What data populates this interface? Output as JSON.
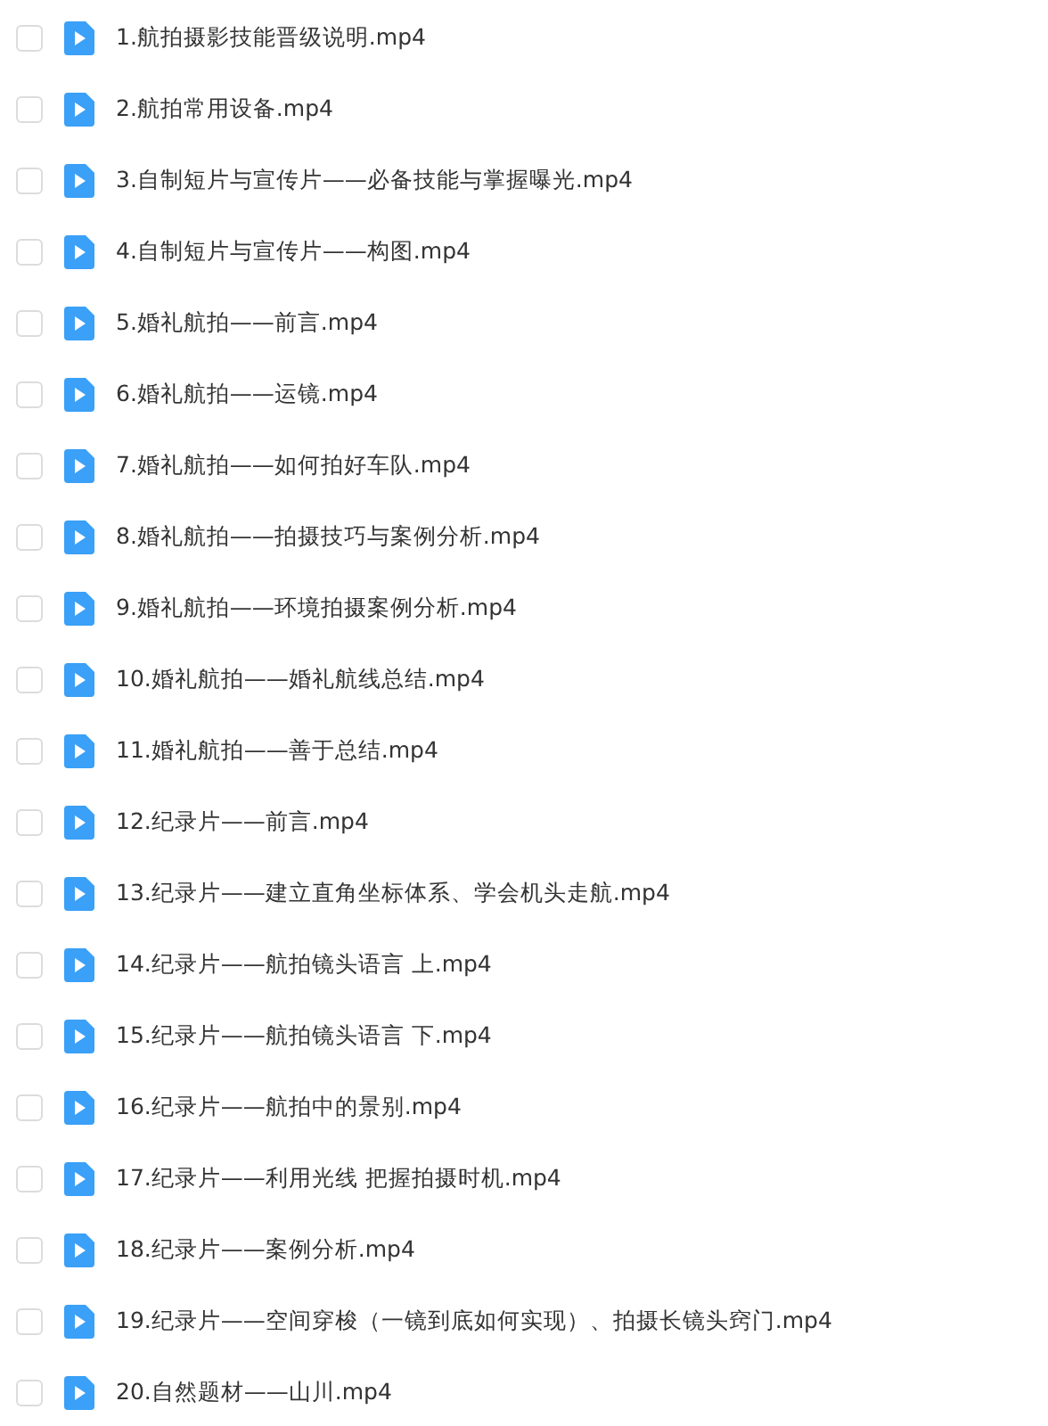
{
  "files": [
    {
      "name": "1.航拍摄影技能晋级说明.mp4",
      "checked": false
    },
    {
      "name": "2.航拍常用设备.mp4",
      "checked": false
    },
    {
      "name": "3.自制短片与宣传片——必备技能与掌握曝光.mp4",
      "checked": false
    },
    {
      "name": "4.自制短片与宣传片——构图.mp4",
      "checked": false
    },
    {
      "name": "5.婚礼航拍——前言.mp4",
      "checked": false
    },
    {
      "name": "6.婚礼航拍——运镜.mp4",
      "checked": false
    },
    {
      "name": "7.婚礼航拍——如何拍好车队.mp4",
      "checked": false
    },
    {
      "name": "8.婚礼航拍——拍摄技巧与案例分析.mp4",
      "checked": false
    },
    {
      "name": "9.婚礼航拍——环境拍摄案例分析.mp4",
      "checked": false
    },
    {
      "name": "10.婚礼航拍——婚礼航线总结.mp4",
      "checked": false
    },
    {
      "name": "11.婚礼航拍——善于总结.mp4",
      "checked": false
    },
    {
      "name": "12.纪录片——前言.mp4",
      "checked": false
    },
    {
      "name": "13.纪录片——建立直角坐标体系、学会机头走航.mp4",
      "checked": false
    },
    {
      "name": "14.纪录片——航拍镜头语言 上.mp4",
      "checked": false
    },
    {
      "name": "15.纪录片——航拍镜头语言 下.mp4",
      "checked": false
    },
    {
      "name": "16.纪录片——航拍中的景别.mp4",
      "checked": false
    },
    {
      "name": "17.纪录片——利用光线 把握拍摄时机.mp4",
      "checked": false
    },
    {
      "name": "18.纪录片——案例分析.mp4",
      "checked": false
    },
    {
      "name": "19.纪录片——空间穿梭（一镜到底如何实现）、拍摄长镜头窍门.mp4",
      "checked": false
    },
    {
      "name": "20.自然题材——山川.mp4",
      "checked": false
    }
  ]
}
